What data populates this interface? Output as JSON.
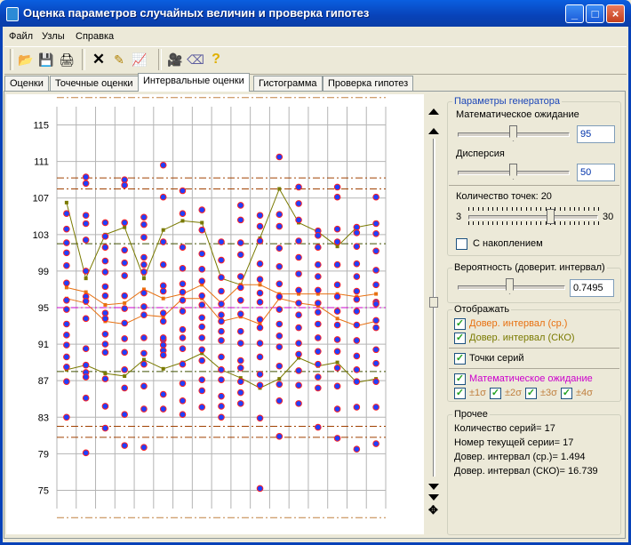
{
  "window": {
    "title": "Оценка параметров случайных величин и проверка гипотез",
    "buttons": [
      "_",
      "□",
      "×"
    ]
  },
  "menu": [
    "Файл",
    "Узлы",
    "Справка"
  ],
  "toolbar": {
    "icons": [
      "open-folder-icon",
      "save-disk-icon",
      "print-icon",
      "delete-x-icon",
      "add-node-icon",
      "chart-icon",
      "camera-icon",
      "eraser-icon",
      "help-icon"
    ]
  },
  "tabs": [
    {
      "label": "Оценки",
      "active": false
    },
    {
      "label": "Точечные оценки",
      "active": false
    },
    {
      "label": "Интервальные оценки",
      "active": true
    },
    {
      "label": "Гистограмма",
      "active": false
    },
    {
      "label": "Проверка гипотез",
      "active": false
    }
  ],
  "chart_data": {
    "type": "scatter",
    "ylim": [
      73,
      117
    ],
    "yticks": [
      "75",
      "79",
      "83",
      "87",
      "91",
      "95",
      "99",
      "103",
      "107",
      "111",
      "115"
    ],
    "n_series": 17,
    "sigma_lines": [
      {
        "label": "±4σ",
        "values": [
          72,
          118
        ],
        "color": "#c08040"
      },
      {
        "label": "±3σ",
        "values": [
          80.8,
          109.2
        ],
        "color": "#a04000"
      },
      {
        "label": "±2σ",
        "values": [
          82,
          108
        ],
        "color": "#a04000"
      },
      {
        "label": "±1σ",
        "values": [
          88,
          102
        ],
        "color": "#405000"
      }
    ],
    "mean_line": {
      "value": 95,
      "color": "#cc00cc"
    },
    "ci_sko_upper": [
      106.5,
      98.2,
      103,
      103.8,
      98.2,
      103.5,
      104.5,
      104.3,
      98.2,
      97.5,
      102.6,
      108,
      104.3,
      103.3,
      101.7,
      103.8,
      104.2
    ],
    "ci_sko_lower": [
      88.2,
      88.7,
      87.8,
      87.5,
      89.3,
      88.3,
      89,
      90,
      88.2,
      87.3,
      86.2,
      87.2,
      89.5,
      88.6,
      89,
      86.8,
      87.2
    ],
    "ci_mean_upper": [
      97.2,
      96.7,
      95.3,
      95.5,
      97,
      96,
      96.5,
      97.5,
      95.5,
      97.5,
      97.5,
      96.5,
      96.5,
      96.5,
      96.5,
      96.2,
      96.5
    ],
    "ci_mean_lower": [
      96,
      95.5,
      93.5,
      93.2,
      94.2,
      94,
      96,
      96,
      93.5,
      94,
      93.2,
      96,
      95.5,
      95.2,
      93.8,
      93,
      93.5
    ],
    "points": [
      [
        105.3,
        103.6,
        102.1,
        101,
        99.6,
        97.7,
        95.8,
        94.8,
        93.2,
        92,
        90.9,
        89.6,
        88.5,
        86.9,
        83
      ],
      [
        109.3,
        108.6,
        105.1,
        104.2,
        102.4,
        99,
        96.2,
        95.7,
        93.8,
        90.5,
        88.7,
        87.9,
        87.4,
        85.1,
        79.1
      ],
      [
        104.3,
        102.8,
        101.6,
        100.1,
        98.9,
        97.3,
        96.3,
        94.4,
        93.8,
        92.1,
        91,
        90.1,
        87.2,
        84.2,
        81.8
      ],
      [
        109,
        108.4,
        104.3,
        101.3,
        99.9,
        98.5,
        96.3,
        94.9,
        93.3,
        91.6,
        90.1,
        88.2,
        86.2,
        83.3,
        79.9
      ],
      [
        104.9,
        104.1,
        102.7,
        100.5,
        99.7,
        98.9,
        96.6,
        95.1,
        94.2,
        91.7,
        90,
        88.8,
        86.4,
        83.9,
        79.7
      ],
      [
        110.6,
        107.1,
        102.2,
        99.7,
        97.4,
        96.8,
        94.4,
        93.5,
        91.5,
        91.7,
        90.9,
        90.3,
        89.8,
        85.5,
        83.9
      ],
      [
        107.8,
        105.3,
        101.6,
        99.3,
        97.6,
        96.7,
        95.8,
        94.6,
        92.6,
        91.7,
        90.5,
        88.8,
        86.7,
        84.8,
        83.3
      ],
      [
        105.7,
        103.5,
        100.9,
        99.2,
        97.9,
        96.3,
        95.3,
        93.9,
        92.9,
        91.7,
        90.4,
        89.2,
        87.1,
        85.9,
        84.1
      ],
      [
        102.2,
        100.2,
        98.3,
        96.8,
        95.4,
        94.2,
        93.5,
        92.4,
        91.4,
        89.6,
        88.2,
        87.1,
        85.3,
        84.2,
        83
      ],
      [
        106.2,
        104.6,
        102.1,
        100.8,
        98.4,
        97.2,
        95.8,
        94.3,
        92.4,
        91.1,
        89.2,
        88.4,
        86.9,
        85.7,
        84.5
      ],
      [
        105.1,
        103.9,
        102.3,
        99.8,
        98.1,
        96.6,
        95.6,
        93.7,
        92.8,
        91.1,
        89.6,
        87.7,
        86.5,
        82.9,
        75.2
      ],
      [
        111.5,
        105.2,
        103.9,
        101.5,
        99.5,
        97.6,
        96.2,
        94.8,
        93.2,
        91.9,
        90.7,
        88.6,
        86.6,
        84.8,
        80.9
      ],
      [
        108.2,
        106.4,
        104.6,
        102.3,
        100.5,
        98.7,
        96.9,
        95.5,
        94.2,
        92.8,
        91.1,
        89.9,
        88.1,
        86.5,
        84.5
      ],
      [
        103.4,
        102.9,
        101.6,
        99.7,
        98.4,
        96.9,
        95.5,
        94.5,
        93.2,
        91.7,
        90.2,
        88.8,
        87.4,
        86.2,
        81.9
      ],
      [
        108.2,
        107.1,
        103.6,
        102.2,
        99.7,
        97.5,
        96.2,
        94.6,
        93.1,
        91.5,
        90.2,
        88.4,
        86.4,
        83.9,
        80.7
      ],
      [
        103.8,
        103.2,
        101.7,
        99.8,
        98.4,
        96.8,
        95.9,
        94.6,
        93.1,
        91.4,
        89.7,
        88.2,
        86.9,
        84.1,
        79.5
      ],
      [
        107.1,
        104.2,
        103.1,
        101.2,
        99.1,
        97.5,
        95.6,
        95.4,
        93.6,
        92.8,
        90.4,
        88.9,
        86.9,
        84.1,
        80.1
      ]
    ]
  },
  "panel": {
    "generator_group": "Параметры генератора",
    "mean_label": "Математическое ожидание",
    "mean_value": "95",
    "mean_slider": 0.5,
    "variance_label": "Дисперсия",
    "variance_value": "50",
    "variance_slider": 0.5,
    "points_label": "Количество точек: 20",
    "points_min": "3",
    "points_max": "30",
    "points_slider": 0.63,
    "accumulate_label": "С накоплением",
    "accumulate_checked": false,
    "probability_group": "Вероятность (доверит. интервал)",
    "probability_value": "0.7495",
    "probability_slider": 0.45,
    "display_group": "Отображать",
    "ci_mean_label": "Довер. интервал (ср.)",
    "ci_sko_label": "Довер. интервал (СКО)",
    "series_points_label": "Точки серий",
    "expectation_label": "Математическое ожидание",
    "sigma_labels": [
      "±1σ",
      "±2σ",
      "±3σ",
      "±4σ"
    ],
    "other_group": "Прочее",
    "stat_series_count": "Количество серий= 17",
    "stat_current_series": "Номер текущей серии= 17",
    "stat_ci_mean": "Довер. интервал (ср.)= 1.494",
    "stat_ci_sko": "Довер. интервал (СКО)= 16.739"
  },
  "colors": {
    "ci_mean": "#e87010",
    "ci_sko": "#7a7a00",
    "mean": "#cc00cc",
    "sigma": "#c08040",
    "point_fill": "#2040ff",
    "point_outline": "#ff2020"
  }
}
